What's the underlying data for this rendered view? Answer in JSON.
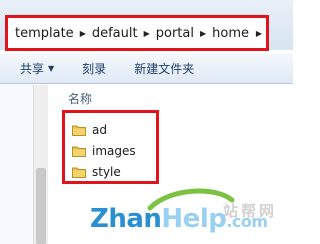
{
  "address_bar": {
    "crumbs": [
      "template",
      "default",
      "portal",
      "home"
    ]
  },
  "toolbar": {
    "share_label": "共享",
    "burn_label": "刻录",
    "new_folder_label": "新建文件夹"
  },
  "file_list": {
    "column_name": "名称",
    "items": [
      "ad",
      "images",
      "style"
    ]
  },
  "watermark": {
    "chinese_text": "站帮网",
    "brand_dark": "Zhan",
    "brand_light": "Help",
    "brand_suffix": ".com"
  },
  "colors": {
    "highlight_border": "#e0141a",
    "folder_yellow": "#e8c04a",
    "toolbar_text": "#1e3f66"
  }
}
